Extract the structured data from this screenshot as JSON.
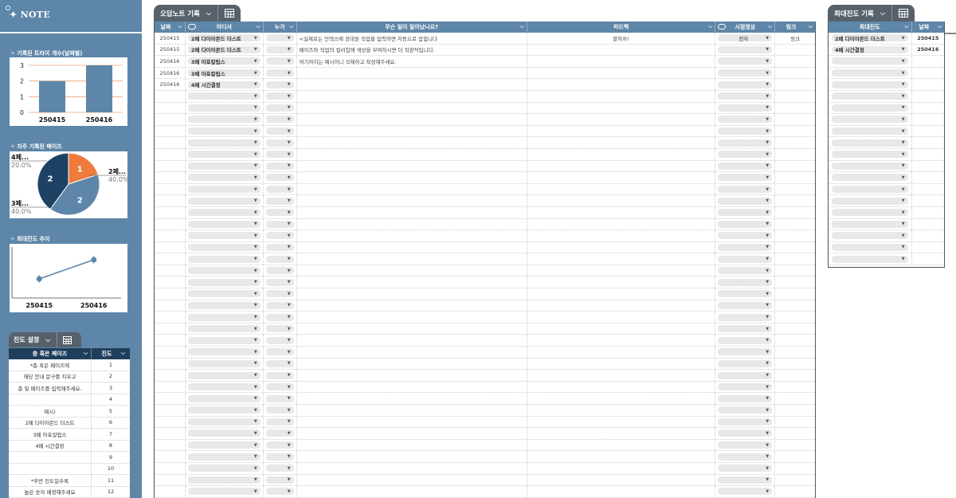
{
  "brand": {
    "title": "✦ NOTE"
  },
  "charts": {
    "bar": {
      "heading": "✧ 기록된 트라이 개수(날짜별)",
      "chart_data": {
        "type": "bar",
        "categories": [
          "250415",
          "250416"
        ],
        "values": [
          2,
          3
        ],
        "ylim": [
          0,
          3
        ],
        "yticks": [
          0,
          1,
          2,
          3
        ],
        "color": "#5e86a8",
        "grid": true
      }
    },
    "pie": {
      "heading": "✧ 자주 기록된 페이즈",
      "chart_data": {
        "type": "pie",
        "slices": [
          {
            "label": "4페...",
            "count": 1,
            "percent": "20.0%",
            "color": "#ee7b3c"
          },
          {
            "label": "2페...",
            "count": 2,
            "percent": "40.0%",
            "color": "#5e86a8"
          },
          {
            "label": "3페...",
            "count": 2,
            "percent": "40.0%",
            "color": "#1d4263"
          }
        ]
      }
    },
    "line": {
      "heading": "✧ 최대진도 추이",
      "chart_data": {
        "type": "line",
        "categories": [
          "250415",
          "250416"
        ],
        "values": [
          6,
          8
        ],
        "ylim": [
          4,
          9
        ],
        "color": "#5e86a8"
      }
    }
  },
  "progress": {
    "tab_label": "진도 설정",
    "headers": {
      "phase": "층 혹은 페이즈",
      "progress": "진도"
    },
    "rows": [
      {
        "phase": "*층 혹은 페이즈에",
        "num": "1"
      },
      {
        "phase": "해당 안내 문구를 지우고",
        "num": "2"
      },
      {
        "phase": "층 및 페이즈를 입력해주세요.",
        "num": "3"
      },
      {
        "phase": "",
        "num": "4"
      },
      {
        "phase": "예시)",
        "num": "5"
      },
      {
        "phase": "2페 다이아몬드 더스트",
        "num": "6"
      },
      {
        "phase": "3페 아포칼립스",
        "num": "7"
      },
      {
        "phase": "4페 시간결정",
        "num": "8"
      },
      {
        "phase": "",
        "num": "9"
      },
      {
        "phase": "",
        "num": "10"
      },
      {
        "phase": "*후반 진도일수록",
        "num": "11"
      },
      {
        "phase": "높은 숫자 배정해주세요",
        "num": "12"
      }
    ]
  },
  "main_tab": {
    "label": "오답노트 기록"
  },
  "main": {
    "headers": {
      "date": "날짜",
      "where": "어디서",
      "who": "누가",
      "what": "무슨 일이 일어났나요?",
      "feedback": "피드백",
      "video": "시점영상",
      "link": "링크"
    },
    "rows": [
      {
        "date": "250415",
        "where": "2페 다이아몬드 더스트",
        "who": "",
        "what": "<실제로는 인덱스에 공대원 직업을 입력하면 자동으로 잡힙니다",
        "feedback": "잘하자!",
        "video": "전자",
        "link": "링크"
      },
      {
        "date": "250415",
        "where": "2페 다이아몬드 더스트",
        "who": "",
        "what": "페이즈와 직업의 컬러칩에 색상을 부여하시면 더 직관적입니다.",
        "feedback": "",
        "video": "",
        "link": ""
      },
      {
        "date": "250416",
        "where": "3페 아포칼립스",
        "who": "",
        "what": "여기까지는 예시이니 삭제하고 작성해주세요.",
        "feedback": "",
        "video": "",
        "link": ""
      },
      {
        "date": "250416",
        "where": "3페 아포칼립스",
        "who": "",
        "what": "",
        "feedback": "",
        "video": "",
        "link": ""
      },
      {
        "date": "250416",
        "where": "4페 시간결정",
        "who": "",
        "what": "",
        "feedback": "",
        "video": "",
        "link": ""
      }
    ]
  },
  "right_tab": {
    "label": "최대진도 기록"
  },
  "right": {
    "headers": {
      "max": "최대진도",
      "date": "날짜"
    },
    "rows": [
      {
        "max": "2페 다이아몬드 더스트",
        "date": "250415"
      },
      {
        "max": "4페 시간결정",
        "date": "250416"
      }
    ]
  }
}
